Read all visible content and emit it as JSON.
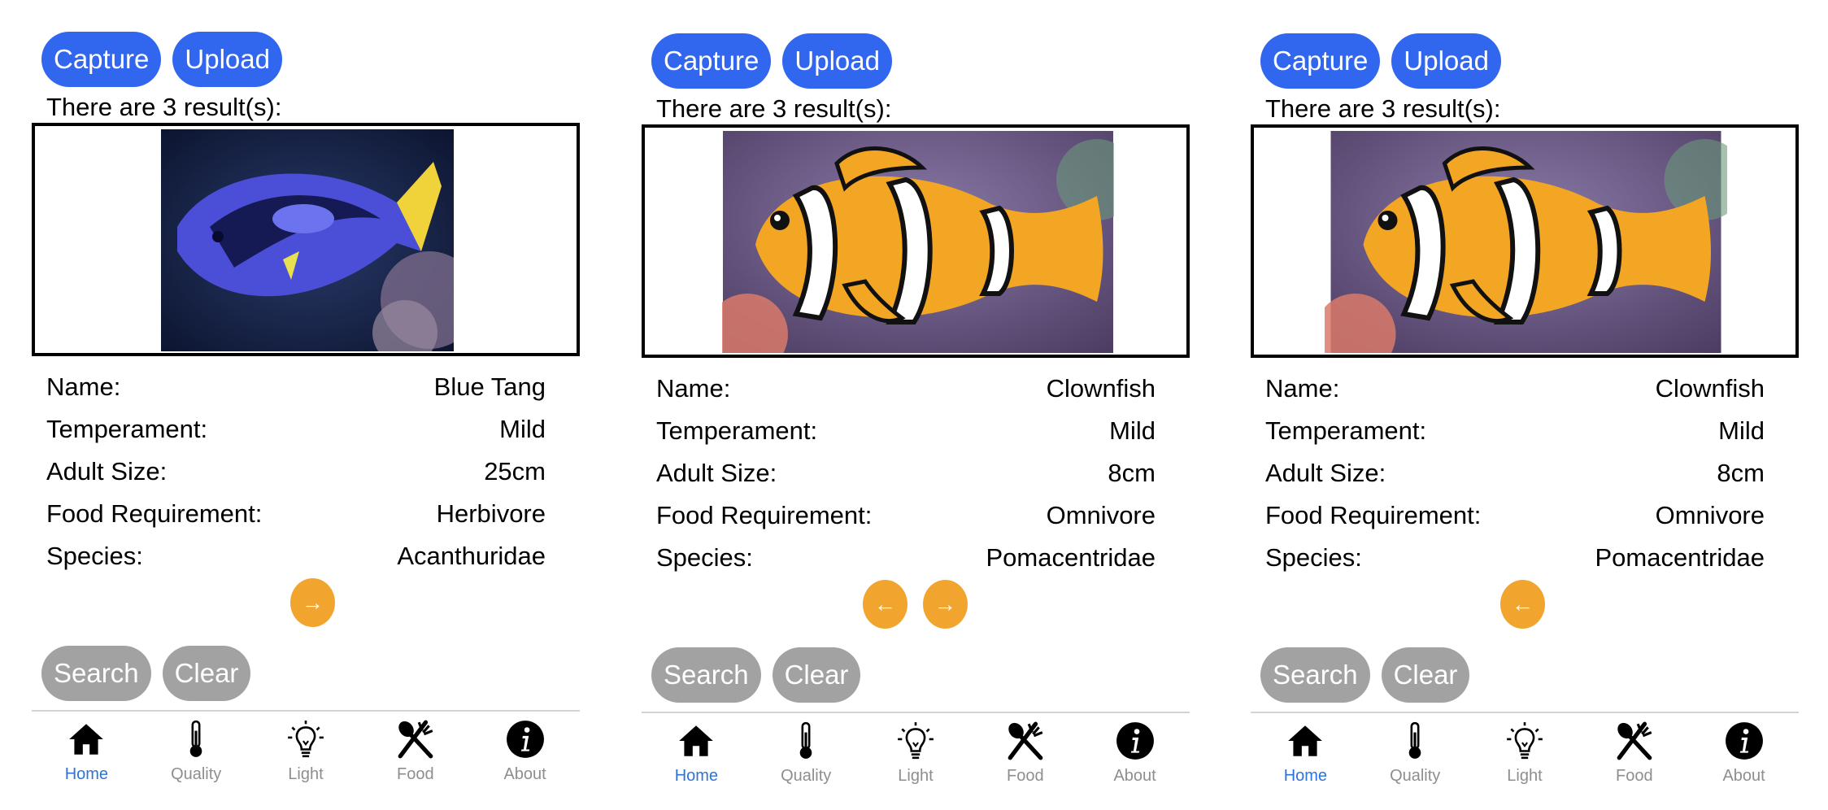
{
  "buttons": {
    "capture": "Capture",
    "upload": "Upload",
    "search": "Search",
    "clear": "Clear"
  },
  "field_labels": {
    "name": "Name:",
    "temperament": "Temperament:",
    "adult_size": "Adult Size:",
    "food": "Food Requirement:",
    "species": "Species:"
  },
  "tabs": [
    {
      "label": "Home",
      "icon": "house-icon",
      "active": true
    },
    {
      "label": "Quality",
      "icon": "thermometer-icon",
      "active": false
    },
    {
      "label": "Light",
      "icon": "lightbulb-icon",
      "active": false
    },
    {
      "label": "Food",
      "icon": "fork-spoon-icon",
      "active": false
    },
    {
      "label": "About",
      "icon": "info-icon",
      "active": false
    }
  ],
  "panels": [
    {
      "result_text": "There are 3 result(s):",
      "photo": "blue-tang-photo",
      "fish": {
        "name": "Blue Tang",
        "temperament": "Mild",
        "adult_size": "25cm",
        "food": "Herbivore",
        "species": "Acanthuridae"
      },
      "nav": {
        "prev": false,
        "next": true,
        "prev_label": "←",
        "next_label": "→"
      }
    },
    {
      "result_text": "There are 3 result(s):",
      "photo": "clownfish-photo",
      "fish": {
        "name": "Clownfish",
        "temperament": "Mild",
        "adult_size": "8cm",
        "food": "Omnivore",
        "species": "Pomacentridae"
      },
      "nav": {
        "prev": true,
        "next": true,
        "prev_label": "←",
        "next_label": "→"
      }
    },
    {
      "result_text": "There are 3 result(s):",
      "photo": "clownfish-photo",
      "fish": {
        "name": "Clownfish",
        "temperament": "Mild",
        "adult_size": "8cm",
        "food": "Omnivore",
        "species": "Pomacentridae"
      },
      "nav": {
        "prev": true,
        "next": false,
        "prev_label": "←",
        "next_label": "→"
      }
    }
  ],
  "colors": {
    "primary_button": "#3166EE",
    "secondary_button": "#A2A2A2",
    "arrow_button": "#F2A52E",
    "active_tab": "#2E74D8",
    "inactive_tab": "#8e8e8e"
  }
}
